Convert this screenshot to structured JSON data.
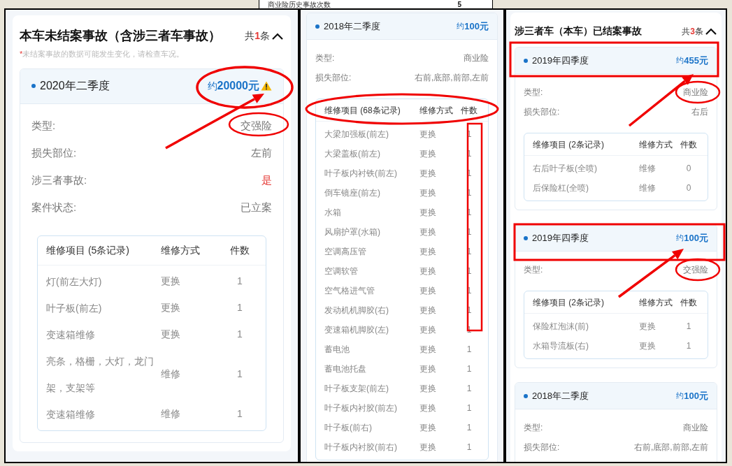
{
  "top_strip": {
    "label": "商业险历史事故次数",
    "value": "5"
  },
  "panels": [
    {
      "title": "本车未结案事故（含涉三者车事故）",
      "count_prefix": "共",
      "count": "1",
      "count_suffix": "条",
      "note_mark": "*",
      "note": "未结案事故的数据可能发生变化，请检查车况。",
      "expanded": true,
      "accidents": [
        {
          "period": "2020年二季度",
          "amount_prefix": "约",
          "amount": "20000元",
          "warning": true,
          "fields": [
            {
              "label": "类型:",
              "value": "交强险",
              "alert": false
            },
            {
              "label": "损失部位:",
              "value": "左前",
              "alert": false
            },
            {
              "label": "涉三者事故:",
              "value": "是",
              "alert": true
            },
            {
              "label": "案件状态:",
              "value": "已立案",
              "alert": false
            }
          ],
          "repairs": {
            "columns": [
              "维修项目 (5条记录)",
              "维修方式",
              "件数"
            ],
            "rows": [
              {
                "item": "灯(前左大灯)",
                "method": "更换",
                "qty": "1"
              },
              {
                "item": "叶子板(前左)",
                "method": "更换",
                "qty": "1"
              },
              {
                "item": "变速箱维修",
                "method": "更换",
                "qty": "1"
              },
              {
                "item": "亮条，格栅，大灯，龙门架，支架等",
                "method": "维修",
                "qty": "1"
              },
              {
                "item": "变速箱维修",
                "method": "维修",
                "qty": "1"
              }
            ]
          }
        }
      ]
    },
    {
      "accidents": [
        {
          "period": "2018年二季度",
          "amount_prefix": "约",
          "amount": "100元",
          "warning": false,
          "fields": [
            {
              "label": "类型:",
              "value": "商业险",
              "alert": false
            },
            {
              "label": "损失部位:",
              "value": "右前,底部,前部,左前",
              "alert": false
            }
          ],
          "repairs": {
            "columns": [
              "维修项目 (68条记录)",
              "维修方式",
              "件数"
            ],
            "rows": [
              {
                "item": "大梁加强板(前左)",
                "method": "更换",
                "qty": "1"
              },
              {
                "item": "大梁盖板(前左)",
                "method": "更换",
                "qty": "1"
              },
              {
                "item": "叶子板内衬铁(前左)",
                "method": "更换",
                "qty": "1"
              },
              {
                "item": "倒车镜座(前左)",
                "method": "更换",
                "qty": "1"
              },
              {
                "item": "水箱",
                "method": "更换",
                "qty": "1"
              },
              {
                "item": "风扇护罩(水箱)",
                "method": "更换",
                "qty": "1"
              },
              {
                "item": "空调高压管",
                "method": "更换",
                "qty": "1"
              },
              {
                "item": "空调软管",
                "method": "更换",
                "qty": "1"
              },
              {
                "item": "空气格进气管",
                "method": "更换",
                "qty": "1"
              },
              {
                "item": "发动机机脚胶(右)",
                "method": "更换",
                "qty": "1"
              },
              {
                "item": "变速箱机脚胶(左)",
                "method": "更换",
                "qty": "1"
              },
              {
                "item": "蓄电池",
                "method": "更换",
                "qty": "1"
              },
              {
                "item": "蓄电池托盘",
                "method": "更换",
                "qty": "1"
              },
              {
                "item": "叶子板支架(前左)",
                "method": "更换",
                "qty": "1"
              },
              {
                "item": "叶子板内衬胶(前左)",
                "method": "更换",
                "qty": "1"
              },
              {
                "item": "叶子板(前右)",
                "method": "更换",
                "qty": "1"
              },
              {
                "item": "叶子板内衬胶(前右)",
                "method": "更换",
                "qty": "1"
              }
            ]
          }
        }
      ]
    },
    {
      "title": "涉三者车（本车）已结案事故",
      "count_prefix": "共",
      "count": "3",
      "count_suffix": "条",
      "expanded": true,
      "accidents": [
        {
          "period": "2019年四季度",
          "amount_prefix": "约",
          "amount": "455元",
          "warning": false,
          "fields": [
            {
              "label": "类型:",
              "value": "商业险",
              "alert": false
            },
            {
              "label": "损失部位:",
              "value": "右后",
              "alert": false
            }
          ],
          "repairs": {
            "columns": [
              "维修项目 (2条记录)",
              "维修方式",
              "件数"
            ],
            "rows": [
              {
                "item": "右后叶子板(全喷)",
                "method": "维修",
                "qty": "0"
              },
              {
                "item": "后保险杠(全喷)",
                "method": "维修",
                "qty": "0"
              }
            ]
          }
        },
        {
          "period": "2019年四季度",
          "amount_prefix": "约",
          "amount": "100元",
          "warning": false,
          "fields": [
            {
              "label": "类型:",
              "value": "交强险",
              "alert": false
            }
          ],
          "repairs": {
            "columns": [
              "维修项目 (2条记录)",
              "维修方式",
              "件数"
            ],
            "rows": [
              {
                "item": "保险杠泡沫(前)",
                "method": "更换",
                "qty": "1"
              },
              {
                "item": "水箱导流板(右)",
                "method": "更换",
                "qty": "1"
              }
            ]
          }
        },
        {
          "period": "2018年二季度",
          "amount_prefix": "约",
          "amount": "100元",
          "warning": false,
          "fields": [
            {
              "label": "类型:",
              "value": "商业险",
              "alert": false
            },
            {
              "label": "损失部位:",
              "value": "右前,底部,前部,左前",
              "alert": false
            }
          ]
        }
      ]
    }
  ]
}
